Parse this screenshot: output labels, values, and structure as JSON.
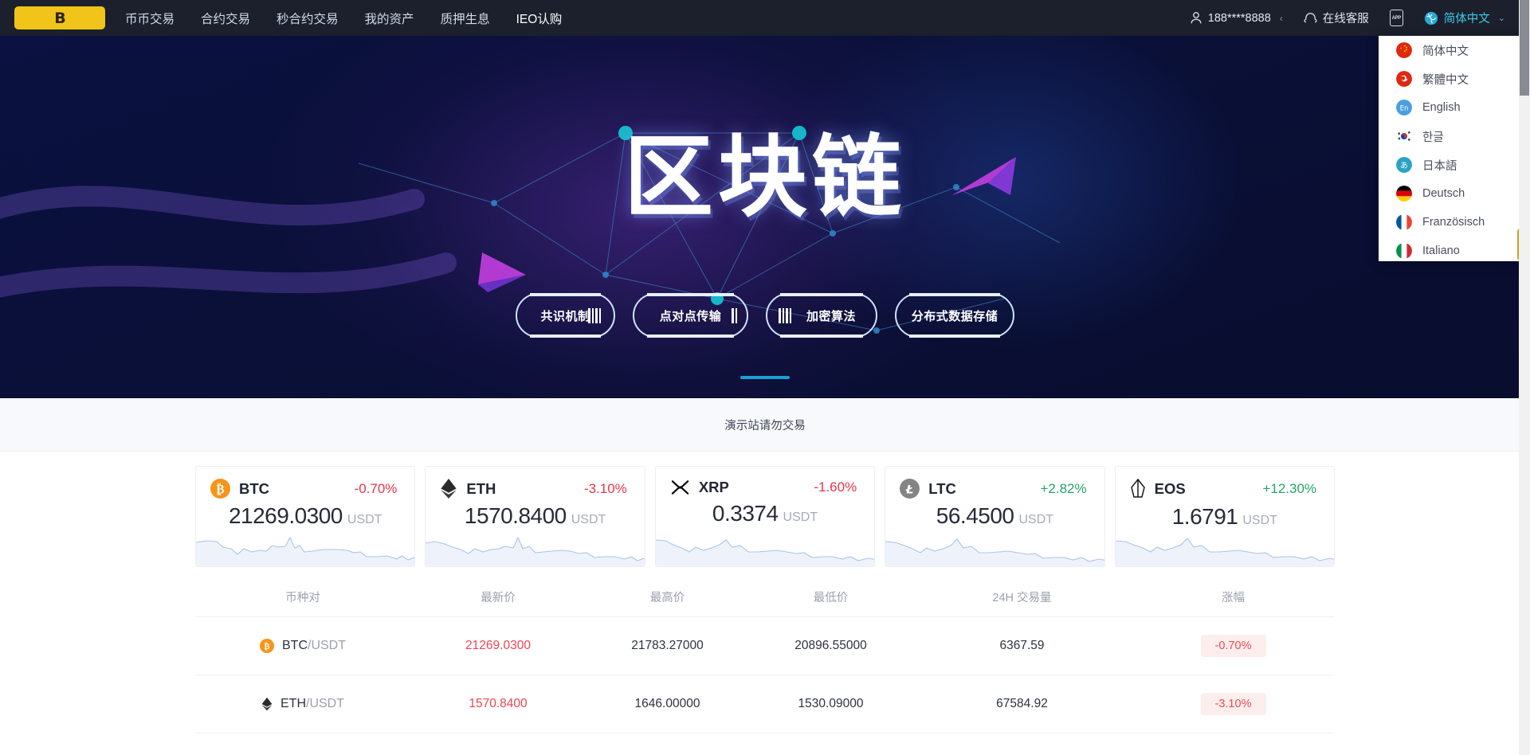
{
  "header": {
    "logo_text": "B",
    "nav": [
      {
        "label": "币币交易",
        "active": false
      },
      {
        "label": "合约交易",
        "active": false
      },
      {
        "label": "秒合约交易",
        "active": false
      },
      {
        "label": "我的资产",
        "active": false
      },
      {
        "label": "质押生息",
        "active": false
      },
      {
        "label": "IEO认购",
        "active": true
      }
    ],
    "user": "188****8888",
    "user_chevron": "‹",
    "support": "在线客服",
    "app_icon_text": "APP",
    "language": "简体中文",
    "language_chevron": "⌄",
    "bg_color": "#1b202c",
    "accent_color": "#3ecbe8",
    "logo_color": "#f0c419"
  },
  "language_dropdown": {
    "items": [
      {
        "label": "简体中文",
        "flag": "cn-flag-icon"
      },
      {
        "label": "繁體中文",
        "flag": "hk-flag-icon"
      },
      {
        "label": "English",
        "flag": "en-badge-icon"
      },
      {
        "label": "한글",
        "flag": "kr-flag-icon"
      },
      {
        "label": "日本語",
        "flag": "jp-badge-icon"
      },
      {
        "label": "Deutsch",
        "flag": "de-flag-icon"
      },
      {
        "label": "Französisch",
        "flag": "fr-flag-icon"
      },
      {
        "label": "Italiano",
        "flag": "it-flag-icon"
      }
    ]
  },
  "banner": {
    "title": "区块链",
    "tags": [
      "共识机制",
      "点对点传输",
      "加密算法",
      "分布式数据存储"
    ],
    "indicator_color": "#1a9fd4"
  },
  "notice": {
    "text": "演示站请勿交易"
  },
  "tickers": [
    {
      "symbol": "BTC",
      "icon": "btc-icon",
      "change": "-0.70%",
      "direction": "down",
      "price": "21269.0300",
      "unit": "USDT"
    },
    {
      "symbol": "ETH",
      "icon": "eth-icon",
      "change": "-3.10%",
      "direction": "down",
      "price": "1570.8400",
      "unit": "USDT"
    },
    {
      "symbol": "XRP",
      "icon": "xrp-icon",
      "change": "-1.60%",
      "direction": "down",
      "price": "0.3374",
      "unit": "USDT"
    },
    {
      "symbol": "LTC",
      "icon": "ltc-icon",
      "change": "+2.82%",
      "direction": "up",
      "price": "56.4500",
      "unit": "USDT"
    },
    {
      "symbol": "EOS",
      "icon": "eos-icon",
      "change": "+12.30%",
      "direction": "up",
      "price": "1.6791",
      "unit": "USDT"
    }
  ],
  "market_table": {
    "headers": [
      "币种对",
      "最新价",
      "最高价",
      "最低价",
      "24H 交易量",
      "涨幅"
    ],
    "rows": [
      {
        "icon": "btc-icon",
        "base": "BTC",
        "quote": "/USDT",
        "last": "21269.0300",
        "high": "21783.27000",
        "low": "20896.55000",
        "volume": "6367.59",
        "change": "-0.70%",
        "direction": "down"
      },
      {
        "icon": "eth-icon",
        "base": "ETH",
        "quote": "/USDT",
        "last": "1570.8400",
        "high": "1646.00000",
        "low": "1530.09000",
        "volume": "67584.92",
        "change": "-3.10%",
        "direction": "down"
      }
    ]
  },
  "colors": {
    "up": "#23a566",
    "down": "#e8344a",
    "last_price": "#f0444f"
  }
}
